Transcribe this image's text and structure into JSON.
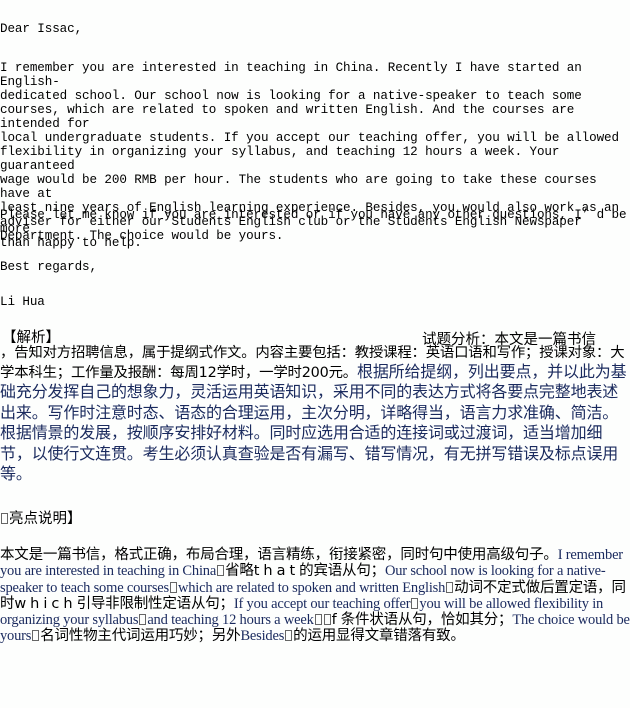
{
  "letter": {
    "salutation": "Dear Issac,",
    "paragraph1": "I remember you are interested in teaching in China. Recently I have started an English-\ndedicated school. Our school now is looking for a native-speaker to teach some\ncourses, which are related to spoken and written English. And the courses are intended for\nlocal undergraduate students. If you accept our teaching offer, you will be allowed\nflexibility in organizing your syllabus, and teaching 12 hours a week. Your guaranteed\nwage would be 200 RMB per hour. The students who are going to take these courses have at\nleast nine years of English learning experience. Besides, you would also work as an\nadviser for either our Students English club or the Students English Newspaper\nDepartment. The choice would be yours.",
    "paragraph2": "Please let me know if you are interested or if you have any other questions, I’ d be more\nthan happy to help.",
    "closing": "Best regards,",
    "signature": "Li Hua"
  },
  "analysis": {
    "heading": "【解析】",
    "intro_label": "试题分析：本文是一篇书信",
    "intro_rest": "，告知对方招聘信息，属于提纲式作文。内容主要包括：教授课程：英语口语和写作；授课对象：大学本科生；工作量及报酬：每周12学时，一学时200元。",
    "guidance": "根据所给提纲，列出要点，并以此为基础充分发挥自己的想象力，灵活运用英语知识，采用不同的表达方式将各要点完整地表述出来。写作时注意时态、语态的合理运用，主次分明，详略得当，语言力求准确、简洁。根据情景的发展，按顺序安排好材料。同时应选用合适的连接词或过渡词，适当增加细节，以使行文连贯。考生必须认真查验是否有漏写、错写情况，有无拼写错误及标点误用等。"
  },
  "highlights": {
    "heading": "亮点说明】",
    "summary": "本文是一篇书信，格式正确，布局合理，语言精练，衔接紧密，同时句中使用高级句子。",
    "s1_en": "I remember you are interested in teaching in China",
    "s1_note_a": "省略",
    "s1_word": "that",
    "s1_note_b": "的宾语从句；",
    "s2_en": "Our school now is looking for a native-speaker to teach some courses",
    "s2_en_b": "which are related to spoken and written English",
    "s2_note": "动词不定式做后置定语，同时",
    "s2_word": "which",
    "s2_note_b": "引导非限制性定语从句；",
    "s3_en": "If you accept our teaching offer",
    "s3_en_b": "you will be allowed flexibility in organizing your syllabus",
    "s3_en_c": "and teaching 12 hours a week",
    "s3_word": "f",
    "s3_note": "条件状语从句，恰如其分；",
    "s4_en": "The choice would be yours",
    "s4_note": "名词性物主代词运用巧妙；另外",
    "s4_word": "Besides",
    "s4_note_b": "的运用显得文章错落有致。"
  }
}
